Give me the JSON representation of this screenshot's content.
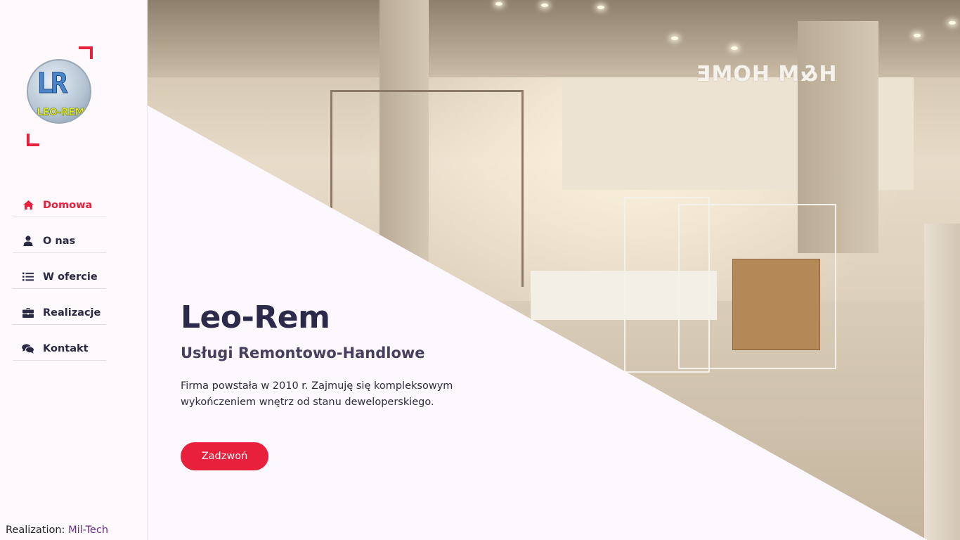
{
  "logo": {
    "letters": "LR",
    "text": "LEO-REM",
    "icon": "leo-rem-logo"
  },
  "accent_color": "#e8203c",
  "nav": {
    "items": [
      {
        "label": "Domowa",
        "icon": "home-icon",
        "active": true
      },
      {
        "label": "O nas",
        "icon": "user-icon",
        "active": false
      },
      {
        "label": "W ofercie",
        "icon": "list-icon",
        "active": false
      },
      {
        "label": "Realizacje",
        "icon": "briefcase-icon",
        "active": false
      },
      {
        "label": "Kontakt",
        "icon": "chat-icon",
        "active": false
      }
    ]
  },
  "footer": {
    "prefix": "Realization:",
    "brand": "Mil-Tech"
  },
  "hero": {
    "title": "Leo-Rem",
    "subtitle": "Usługi Remontowo-Handlowe",
    "description": "Firma powstała w 2010 r. Zajmuję się kompleksowym wykończeniem wnętrz od stanu deweloperskiego.",
    "cta_label": "Zadzwoń",
    "photo_sign": "H&M HOME"
  }
}
